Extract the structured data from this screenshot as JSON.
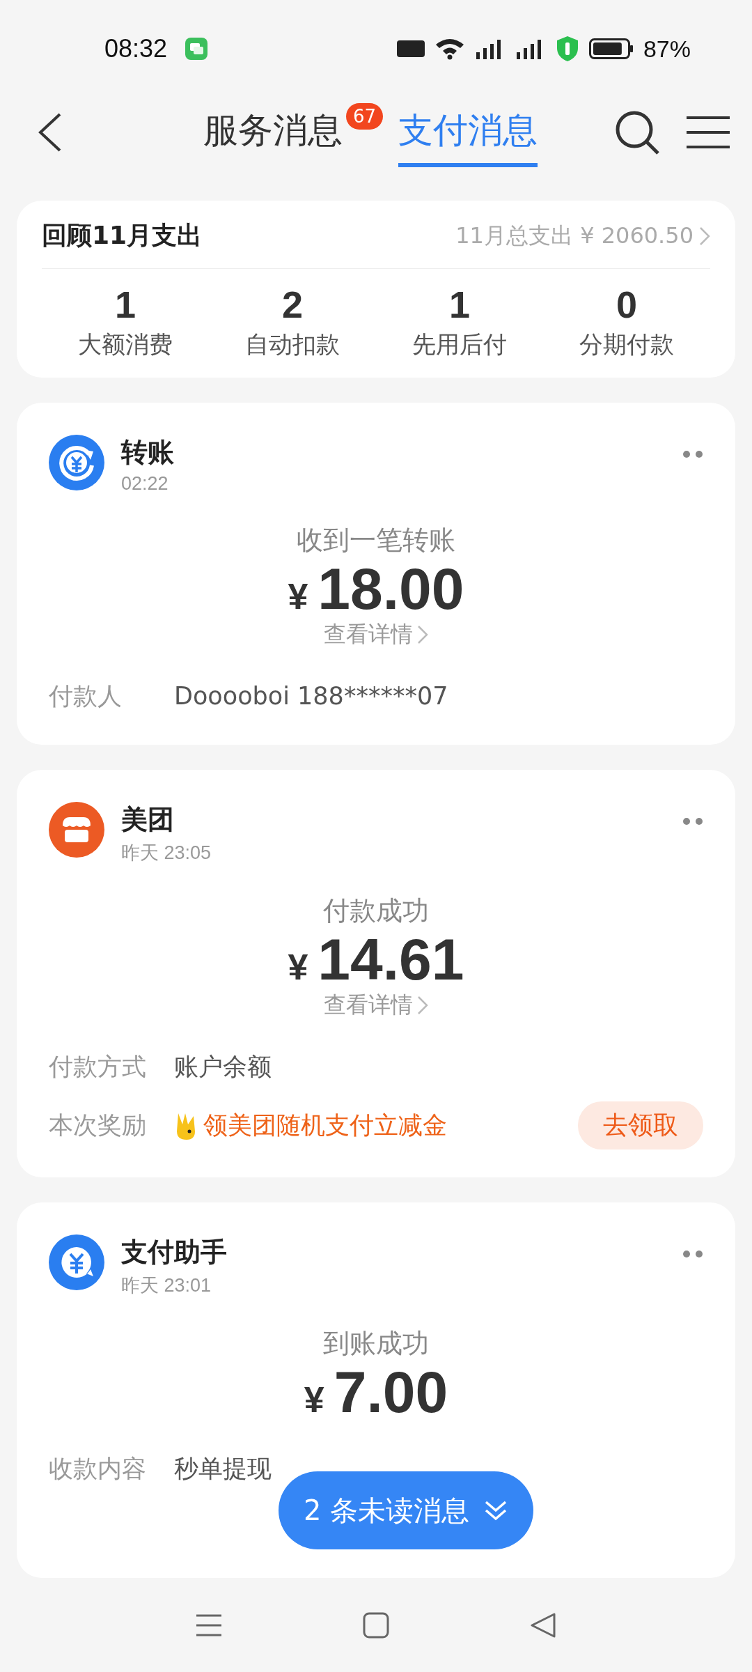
{
  "status_bar": {
    "time": "08:32",
    "battery": "87%"
  },
  "header": {
    "tabs": [
      {
        "label": "服务消息",
        "selected": false,
        "badge": "67"
      },
      {
        "label": "支付消息",
        "selected": true
      }
    ]
  },
  "summary": {
    "title": "回顾11月支出",
    "total": "11月总支出 ¥ 2060.50",
    "stats": [
      {
        "value": "1",
        "label": "大额消费"
      },
      {
        "value": "2",
        "label": "自动扣款"
      },
      {
        "value": "1",
        "label": "先用后付"
      },
      {
        "value": "0",
        "label": "分期付款"
      }
    ]
  },
  "messages": [
    {
      "kind": "transfer",
      "color": "#2a7ef0",
      "title": "转账",
      "time": "02:22",
      "status": "收到一笔转账",
      "currency": "¥",
      "amount": "18.00",
      "detail": "查看详情",
      "rows": [
        {
          "label": "付款人",
          "value": "Dooooboi 188******07"
        }
      ]
    },
    {
      "kind": "store",
      "color": "#ec5a24",
      "title": "美团",
      "time": "昨天 23:05",
      "status": "付款成功",
      "currency": "¥",
      "amount": "14.61",
      "detail": "查看详情",
      "rows": [
        {
          "label": "付款方式",
          "value": "账户余额"
        },
        {
          "label": "本次奖励",
          "value": "领美团随机支付立减金",
          "kind": "reward",
          "action": "去领取"
        }
      ]
    },
    {
      "kind": "assistant",
      "color": "#2a7ef0",
      "title": "支付助手",
      "time": "昨天 23:01",
      "status": "到账成功",
      "currency": "¥",
      "amount": "7.00",
      "rows": [
        {
          "label": "收款内容",
          "value": "秒单提现"
        }
      ]
    }
  ],
  "unread_button": {
    "label": "2 条未读消息"
  }
}
